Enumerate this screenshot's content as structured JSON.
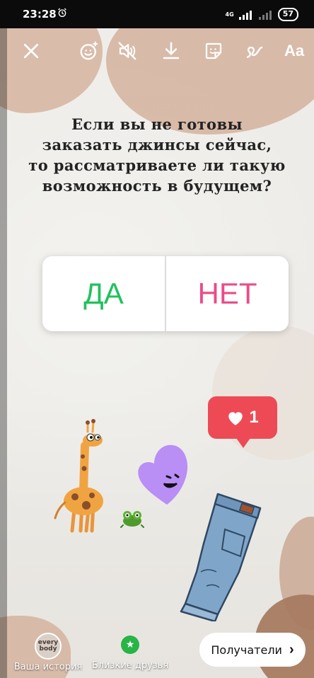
{
  "status": {
    "time": "23:28",
    "network": "4G",
    "battery": "57"
  },
  "toolbar": {
    "text_tool": "Aa"
  },
  "story": {
    "question": "Если вы не готовы\nзаказать джинсы сейчас,\nто рассматриваете ли такую\nвозможность в будущем?",
    "poll": {
      "yes": "ДА",
      "no": "НЕТ"
    },
    "like_count": "1",
    "avatar_text": "every\nbody"
  },
  "bottom": {
    "your_story": "Ваша история",
    "close_friends": "Близкие друзья",
    "recipients": "Получатели",
    "recipients_chevron": "›"
  }
}
